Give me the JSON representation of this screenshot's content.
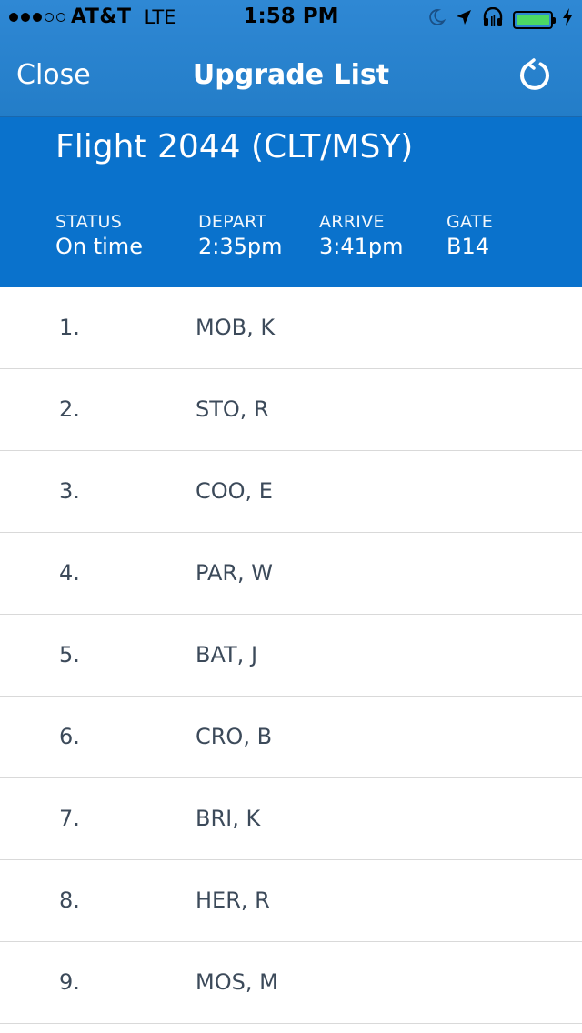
{
  "status_bar": {
    "signal_full": 3,
    "signal_total": 5,
    "carrier": "AT&T",
    "network": "LTE",
    "time": "1:58 PM",
    "icons": [
      "moon-icon",
      "location-arrow-icon",
      "headphones-icon",
      "battery-charging-icon"
    ],
    "battery_level": 1.0,
    "battery_color": "#4cd964"
  },
  "nav": {
    "close_label": "Close",
    "title": "Upgrade List",
    "refresh_icon": "refresh-icon"
  },
  "flight": {
    "title": "Flight 2044 (CLT/MSY)",
    "status_label": "STATUS",
    "status_value": "On time",
    "depart_label": "DEPART",
    "depart_value": "2:35pm",
    "arrive_label": "ARRIVE",
    "arrive_value": "3:41pm",
    "gate_label": "GATE",
    "gate_value": "B14"
  },
  "upgrade_list": [
    {
      "rank": "1.",
      "name": "MOB, K"
    },
    {
      "rank": "2.",
      "name": "STO, R"
    },
    {
      "rank": "3.",
      "name": "COO, E"
    },
    {
      "rank": "4.",
      "name": "PAR, W"
    },
    {
      "rank": "5.",
      "name": "BAT, J"
    },
    {
      "rank": "6.",
      "name": "CRO, B"
    },
    {
      "rank": "7.",
      "name": "BRI, K"
    },
    {
      "rank": "8.",
      "name": "HER, R"
    },
    {
      "rank": "9.",
      "name": "MOS, M"
    }
  ],
  "colors": {
    "nav_blue": "#2f88d4",
    "panel_blue": "#0a72cc",
    "list_text": "#3c4a5a"
  }
}
